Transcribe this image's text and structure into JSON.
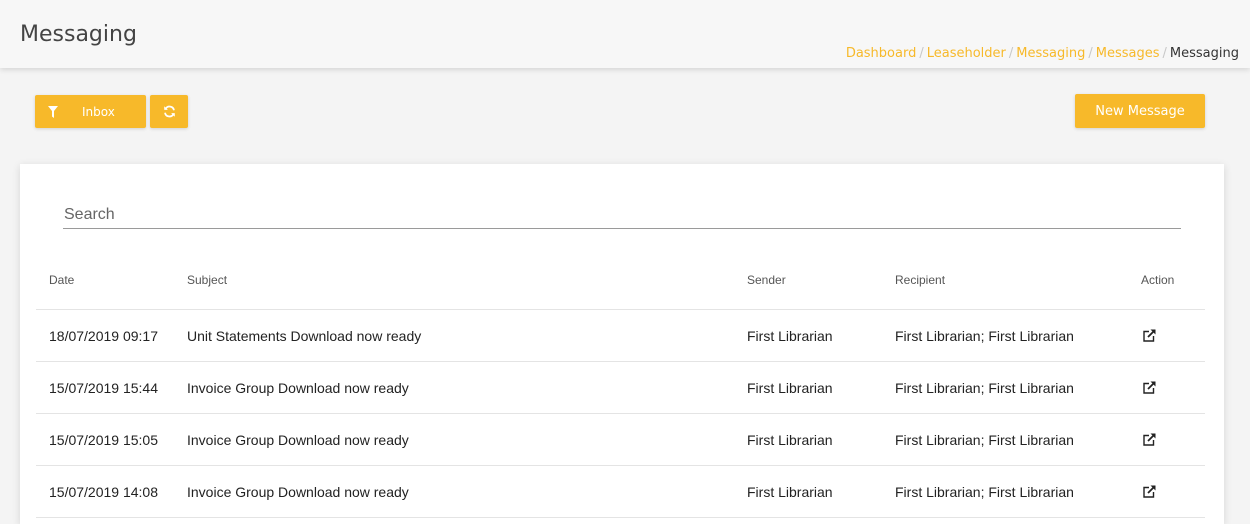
{
  "header": {
    "title": "Messaging",
    "breadcrumb": [
      "Dashboard",
      "Leaseholder",
      "Messaging",
      "Messages"
    ],
    "breadcrumb_current": "Messaging"
  },
  "toolbar": {
    "inbox_label": "Inbox",
    "new_message_label": "New Message"
  },
  "search": {
    "placeholder": "Search",
    "value": ""
  },
  "table": {
    "columns": {
      "date": "Date",
      "subject": "Subject",
      "sender": "Sender",
      "recipient": "Recipient",
      "action": "Action"
    },
    "rows": [
      {
        "date": "18/07/2019 09:17",
        "subject": "Unit Statements Download now ready",
        "sender": "First Librarian",
        "recipient": "First Librarian; First Librarian",
        "action_icon": "external-link-icon"
      },
      {
        "date": "15/07/2019 15:44",
        "subject": "Invoice Group Download now ready",
        "sender": "First Librarian",
        "recipient": "First Librarian; First Librarian",
        "action_icon": "external-link-icon"
      },
      {
        "date": "15/07/2019 15:05",
        "subject": "Invoice Group Download now ready",
        "sender": "First Librarian",
        "recipient": "First Librarian; First Librarian",
        "action_icon": "external-link-icon"
      },
      {
        "date": "15/07/2019 14:08",
        "subject": "Invoice Group Download now ready",
        "sender": "First Librarian",
        "recipient": "First Librarian; First Librarian",
        "action_icon": "external-link-icon"
      }
    ]
  },
  "colors": {
    "accent": "#f7b92a",
    "background": "#f4f4f4",
    "card": "#ffffff"
  }
}
